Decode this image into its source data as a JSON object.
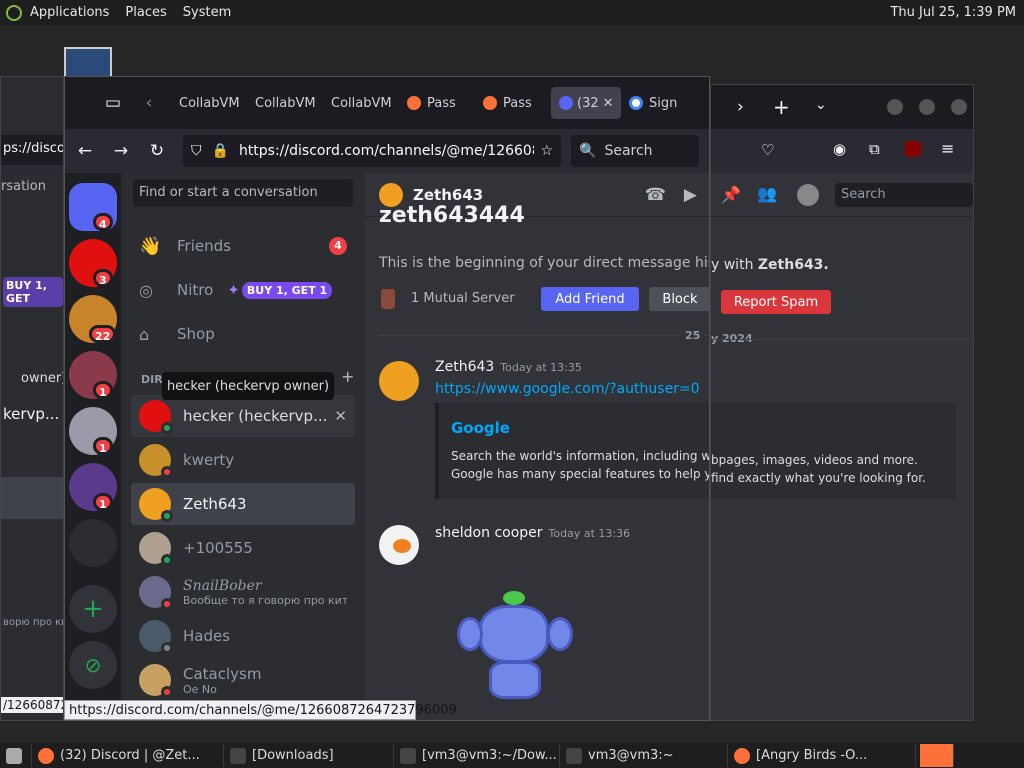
{
  "panel": {
    "menus": [
      "Applications",
      "Places",
      "System"
    ],
    "clock": "Thu Jul 25,  1:39 PM"
  },
  "firefox": {
    "tabs": [
      "CollabVM",
      "CollabVM",
      "CollabVM",
      "Pass",
      "Pass",
      "(32",
      "Sign"
    ],
    "url": "https://discord.com/channels/@me/12660872",
    "search_placeholder": "Search"
  },
  "guild_badges": [
    "4",
    "3",
    "22",
    "1",
    "1",
    "1"
  ],
  "dm": {
    "search_placeholder": "Find or start a conversation",
    "friends": "Friends",
    "friends_badge": "4",
    "nitro": "Nitro",
    "nitro_promo": "BUY 1, GET 1",
    "shop": "Shop",
    "direct_messages_header": "DIR",
    "items": [
      {
        "name": "hecker (heckervp...",
        "sub": ""
      },
      {
        "name": "kwerty",
        "sub": ""
      },
      {
        "name": "Zeth643",
        "sub": ""
      },
      {
        "name": "+100555",
        "sub": ""
      },
      {
        "name": "SnailBober",
        "sub": "Вообще то я говорю про кит..."
      },
      {
        "name": "Hades",
        "sub": ""
      },
      {
        "name": "Cataclysm",
        "sub": "Oe No"
      }
    ]
  },
  "tooltip": "hecker (heckervp owner)",
  "chat": {
    "header": "Zeth643",
    "big_name": "zeth643444",
    "intro": "This is the beginning of your direct message hist",
    "intro_tail": "y with",
    "intro_name": "Zeth643.",
    "mutual": "1 Mutual Server",
    "add_friend": "Add Friend",
    "block": "Block",
    "report": "Report Spam",
    "date_divider": "25",
    "date_divider_year": "y 2024",
    "messages": [
      {
        "author": "Zeth643",
        "time": "Today at 13:35",
        "link": "https://www.google.com/?authuser=0",
        "embed_title": "Google",
        "embed_desc": "Search the world's information, including w",
        "embed_desc2": "Google has many special features to help y"
      },
      {
        "author": "sheldon cooper",
        "time": "Today at 13:36"
      }
    ],
    "embed_tail1": "bpages, images, videos and more.",
    "embed_tail2": "find exactly what you're looking for.",
    "right_search": "Search"
  },
  "status_url": "https://discord.com/channels/@me/1266087264723796009",
  "bg_window": {
    "url_frag": "ps://discor",
    "conv": "rsation",
    "promo": "BUY 1, GET",
    "owner": "owner)",
    "user": "kervp...",
    "link": "/12660872",
    "cyr": "ворю про ки"
  },
  "taskbar": [
    "(32) Discord | @Zet...",
    "[Downloads]",
    "[vm3@vm3:~/Dow...",
    "vm3@vm3:~",
    "[Angry Birds - ",
    "O..."
  ]
}
